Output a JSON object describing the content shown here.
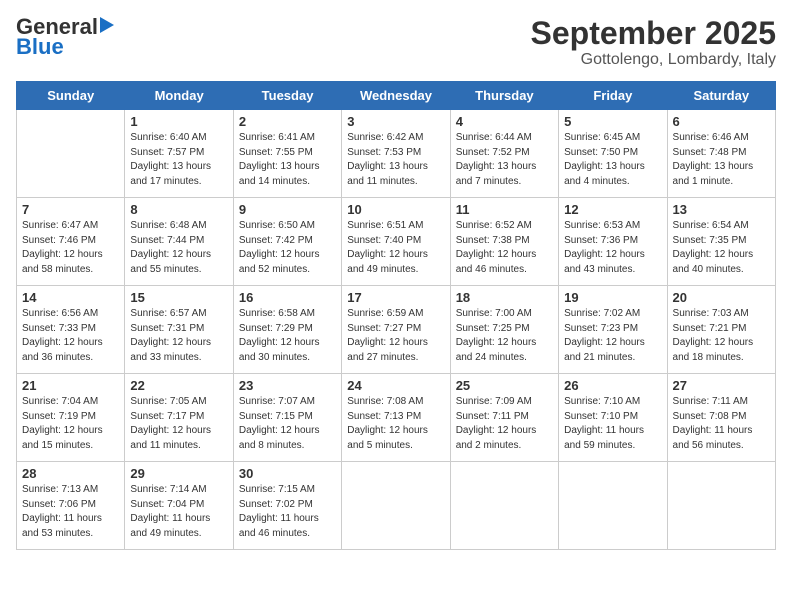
{
  "logo": {
    "general": "General",
    "blue": "Blue"
  },
  "title": "September 2025",
  "location": "Gottolengo, Lombardy, Italy",
  "days": [
    "Sunday",
    "Monday",
    "Tuesday",
    "Wednesday",
    "Thursday",
    "Friday",
    "Saturday"
  ],
  "weeks": [
    [
      {
        "date": "",
        "info": ""
      },
      {
        "date": "1",
        "info": "Sunrise: 6:40 AM\nSunset: 7:57 PM\nDaylight: 13 hours\nand 17 minutes."
      },
      {
        "date": "2",
        "info": "Sunrise: 6:41 AM\nSunset: 7:55 PM\nDaylight: 13 hours\nand 14 minutes."
      },
      {
        "date": "3",
        "info": "Sunrise: 6:42 AM\nSunset: 7:53 PM\nDaylight: 13 hours\nand 11 minutes."
      },
      {
        "date": "4",
        "info": "Sunrise: 6:44 AM\nSunset: 7:52 PM\nDaylight: 13 hours\nand 7 minutes."
      },
      {
        "date": "5",
        "info": "Sunrise: 6:45 AM\nSunset: 7:50 PM\nDaylight: 13 hours\nand 4 minutes."
      },
      {
        "date": "6",
        "info": "Sunrise: 6:46 AM\nSunset: 7:48 PM\nDaylight: 13 hours\nand 1 minute."
      }
    ],
    [
      {
        "date": "7",
        "info": "Sunrise: 6:47 AM\nSunset: 7:46 PM\nDaylight: 12 hours\nand 58 minutes."
      },
      {
        "date": "8",
        "info": "Sunrise: 6:48 AM\nSunset: 7:44 PM\nDaylight: 12 hours\nand 55 minutes."
      },
      {
        "date": "9",
        "info": "Sunrise: 6:50 AM\nSunset: 7:42 PM\nDaylight: 12 hours\nand 52 minutes."
      },
      {
        "date": "10",
        "info": "Sunrise: 6:51 AM\nSunset: 7:40 PM\nDaylight: 12 hours\nand 49 minutes."
      },
      {
        "date": "11",
        "info": "Sunrise: 6:52 AM\nSunset: 7:38 PM\nDaylight: 12 hours\nand 46 minutes."
      },
      {
        "date": "12",
        "info": "Sunrise: 6:53 AM\nSunset: 7:36 PM\nDaylight: 12 hours\nand 43 minutes."
      },
      {
        "date": "13",
        "info": "Sunrise: 6:54 AM\nSunset: 7:35 PM\nDaylight: 12 hours\nand 40 minutes."
      }
    ],
    [
      {
        "date": "14",
        "info": "Sunrise: 6:56 AM\nSunset: 7:33 PM\nDaylight: 12 hours\nand 36 minutes."
      },
      {
        "date": "15",
        "info": "Sunrise: 6:57 AM\nSunset: 7:31 PM\nDaylight: 12 hours\nand 33 minutes."
      },
      {
        "date": "16",
        "info": "Sunrise: 6:58 AM\nSunset: 7:29 PM\nDaylight: 12 hours\nand 30 minutes."
      },
      {
        "date": "17",
        "info": "Sunrise: 6:59 AM\nSunset: 7:27 PM\nDaylight: 12 hours\nand 27 minutes."
      },
      {
        "date": "18",
        "info": "Sunrise: 7:00 AM\nSunset: 7:25 PM\nDaylight: 12 hours\nand 24 minutes."
      },
      {
        "date": "19",
        "info": "Sunrise: 7:02 AM\nSunset: 7:23 PM\nDaylight: 12 hours\nand 21 minutes."
      },
      {
        "date": "20",
        "info": "Sunrise: 7:03 AM\nSunset: 7:21 PM\nDaylight: 12 hours\nand 18 minutes."
      }
    ],
    [
      {
        "date": "21",
        "info": "Sunrise: 7:04 AM\nSunset: 7:19 PM\nDaylight: 12 hours\nand 15 minutes."
      },
      {
        "date": "22",
        "info": "Sunrise: 7:05 AM\nSunset: 7:17 PM\nDaylight: 12 hours\nand 11 minutes."
      },
      {
        "date": "23",
        "info": "Sunrise: 7:07 AM\nSunset: 7:15 PM\nDaylight: 12 hours\nand 8 minutes."
      },
      {
        "date": "24",
        "info": "Sunrise: 7:08 AM\nSunset: 7:13 PM\nDaylight: 12 hours\nand 5 minutes."
      },
      {
        "date": "25",
        "info": "Sunrise: 7:09 AM\nSunset: 7:11 PM\nDaylight: 12 hours\nand 2 minutes."
      },
      {
        "date": "26",
        "info": "Sunrise: 7:10 AM\nSunset: 7:10 PM\nDaylight: 11 hours\nand 59 minutes."
      },
      {
        "date": "27",
        "info": "Sunrise: 7:11 AM\nSunset: 7:08 PM\nDaylight: 11 hours\nand 56 minutes."
      }
    ],
    [
      {
        "date": "28",
        "info": "Sunrise: 7:13 AM\nSunset: 7:06 PM\nDaylight: 11 hours\nand 53 minutes."
      },
      {
        "date": "29",
        "info": "Sunrise: 7:14 AM\nSunset: 7:04 PM\nDaylight: 11 hours\nand 49 minutes."
      },
      {
        "date": "30",
        "info": "Sunrise: 7:15 AM\nSunset: 7:02 PM\nDaylight: 11 hours\nand 46 minutes."
      },
      {
        "date": "",
        "info": ""
      },
      {
        "date": "",
        "info": ""
      },
      {
        "date": "",
        "info": ""
      },
      {
        "date": "",
        "info": ""
      }
    ]
  ]
}
